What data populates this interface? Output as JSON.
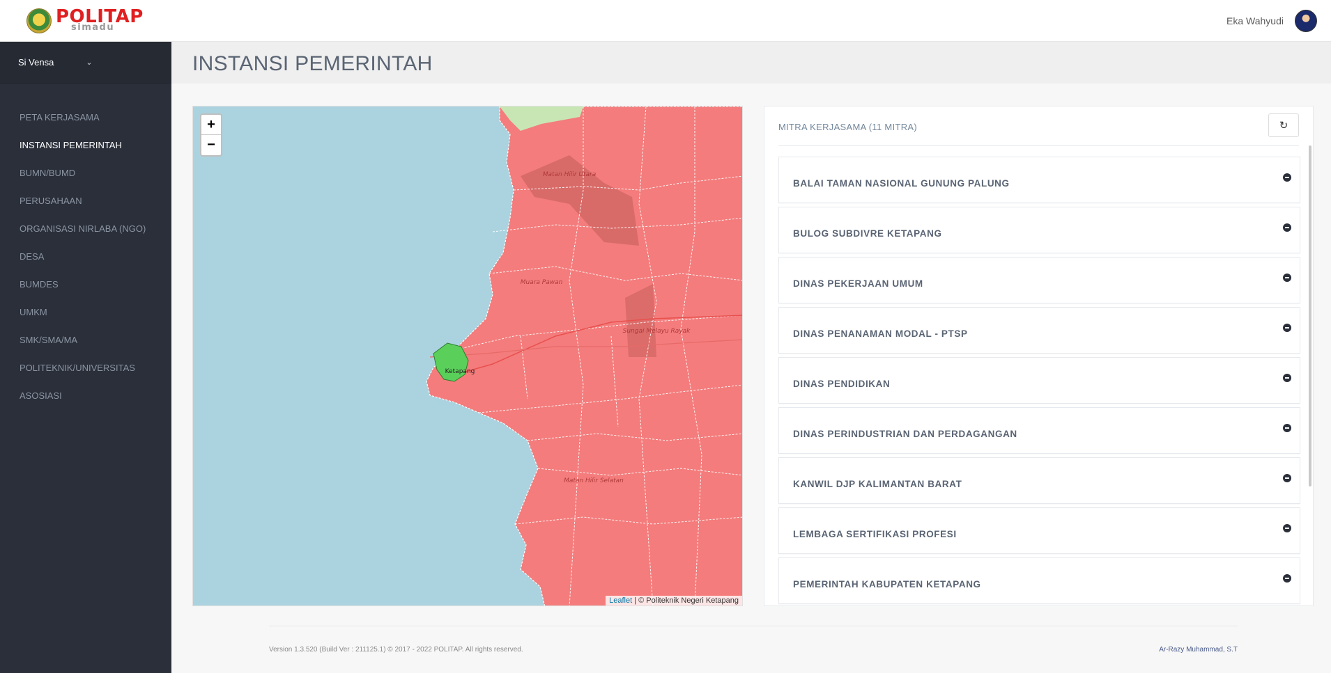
{
  "header": {
    "logo_text": "POLITAP",
    "logo_sub": "simadu",
    "user_name": "Eka Wahyudi"
  },
  "sidebar": {
    "app_switch_label": "Si Vensa",
    "items": [
      {
        "label": "PETA KERJASAMA",
        "active": false
      },
      {
        "label": "INSTANSI PEMERINTAH",
        "active": true
      },
      {
        "label": "BUMN/BUMD",
        "active": false
      },
      {
        "label": "PERUSAHAAN",
        "active": false
      },
      {
        "label": "ORGANISASI NIRLABA (NGO)",
        "active": false
      },
      {
        "label": "DESA",
        "active": false
      },
      {
        "label": "BUMDES",
        "active": false
      },
      {
        "label": "UMKM",
        "active": false
      },
      {
        "label": "SMK/SMA/MA",
        "active": false
      },
      {
        "label": "POLITEKNIK/UNIVERSITAS",
        "active": false
      },
      {
        "label": "ASOSIASI",
        "active": false
      }
    ]
  },
  "page": {
    "title": "INSTANSI PEMERINTAH"
  },
  "map": {
    "zoom_in": "+",
    "zoom_out": "−",
    "attribution_link": "Leaflet",
    "attribution_text": " | © Politeknik Negeri Ketapang",
    "place_labels": {
      "matan_hilir_utara": "Matan Hilir Utara",
      "muara_pawan": "Muara Pawan",
      "sungai_melayu_rayak": "Sungai Melayu Rayak",
      "ketapang": "Ketapang",
      "matan_hilir_selatan": "Matan Hilir Selatan"
    },
    "colors": {
      "water": "#aad3df",
      "region": "#f47c7c",
      "highlight": "#5ad05a"
    }
  },
  "panel": {
    "title": "MITRA KERJASAMA (11 MITRA)",
    "refresh_icon": "refresh-icon",
    "items": [
      "BALAI TAMAN NASIONAL GUNUNG PALUNG",
      "BULOG SUBDIVRE KETAPANG",
      "DINAS PEKERJAAN UMUM",
      "DINAS PENANAMAN MODAL - PTSP",
      "DINAS PENDIDIKAN",
      "DINAS PERINDUSTRIAN DAN PERDAGANGAN",
      "KANWIL DJP KALIMANTAN BARAT",
      "LEMBAGA SERTIFIKASI PROFESI",
      "PEMERINTAH KABUPATEN KETAPANG"
    ]
  },
  "footer": {
    "version": "Version 1.3.520 (Build Ver : 211125.1) © 2017 - 2022 POLITAP. All rights reserved.",
    "author": "Ar-Razy Muhammad, S.T"
  }
}
